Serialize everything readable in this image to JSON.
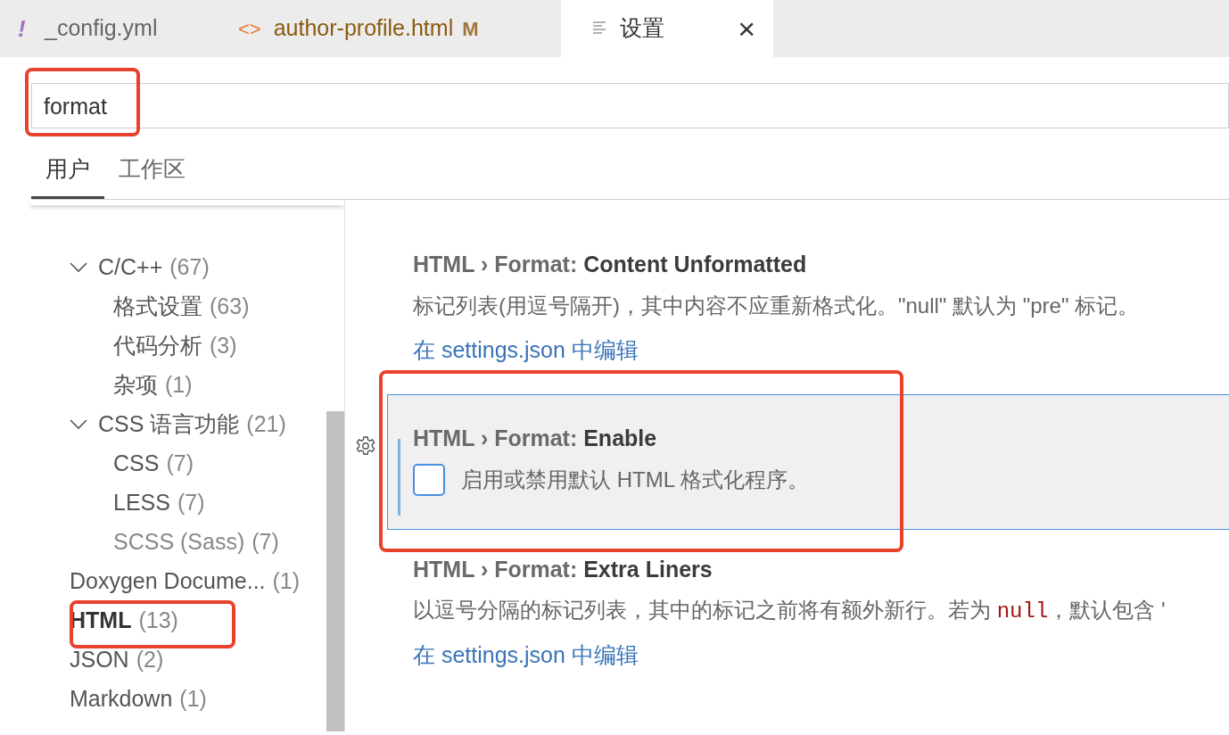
{
  "tabs": [
    {
      "icon": "!",
      "label": "_config.yml",
      "selected": false,
      "kind": "yaml"
    },
    {
      "icon": "<>",
      "label": "author-profile.html",
      "badge": "M",
      "selected": false,
      "kind": "html"
    },
    {
      "label": "设置",
      "selected": true,
      "kind": "settings",
      "close": "×"
    }
  ],
  "search": {
    "value": "format",
    "highlighted": true
  },
  "scope_tabs": [
    {
      "label": "用户",
      "selected": true
    },
    {
      "label": "工作区",
      "selected": false
    }
  ],
  "tree": [
    {
      "label": "C/C++",
      "count": "(67)",
      "expanded": true,
      "children": [
        {
          "label": "格式设置",
          "count": "(63)"
        },
        {
          "label": "代码分析",
          "count": "(3)"
        },
        {
          "label": "杂项",
          "count": "(1)"
        }
      ]
    },
    {
      "label": "CSS 语言功能",
      "count": "(21)",
      "expanded": true,
      "children": [
        {
          "label": "CSS",
          "count": "(7)"
        },
        {
          "label": "LESS",
          "count": "(7)"
        },
        {
          "label": "SCSS (Sass)",
          "count": "(7)",
          "dimmed": true
        }
      ]
    },
    {
      "label": "Doxygen Docume...",
      "count": "(1)"
    },
    {
      "label": "HTML",
      "count": "(13)",
      "selected": true,
      "highlighted": true
    },
    {
      "label": "JSON",
      "count": "(2)"
    },
    {
      "label": "Markdown",
      "count": "(1)"
    }
  ],
  "settings": [
    {
      "prefix": "HTML › Format: ",
      "name": "Content Unformatted",
      "kind": "text",
      "description": [
        "标记列表(用逗号隔开)，其中内容不应重新格式化。\"null\" 默认为 \"pre\" 标记。"
      ],
      "link": "在 settings.json 中编辑",
      "focused": false
    },
    {
      "prefix": "HTML › Format: ",
      "name": "Enable",
      "kind": "checkbox",
      "checked": false,
      "description": [
        "启用或禁用默认 HTML 格式化程序。"
      ],
      "focused": true,
      "highlighted": true
    },
    {
      "prefix": "HTML › Format: ",
      "name": "Extra Liners",
      "kind": "text",
      "description": [
        "以逗号分隔的标记列表，其中的标记之前将有额外新行。若为 ",
        {
          "code": "null"
        },
        "，默认包含 '"
      ],
      "link": "在 settings.json 中编辑",
      "focused": false
    }
  ]
}
